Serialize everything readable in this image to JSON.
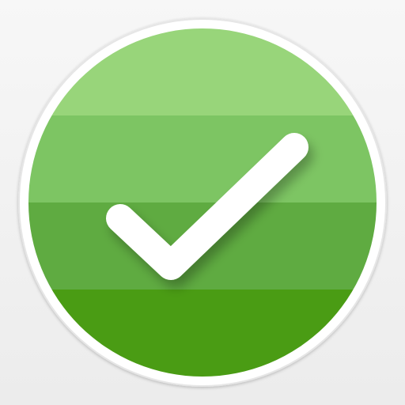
{
  "app_icon": {
    "icon": "checkmark-icon",
    "colors": {
      "background": "#f2f2f2",
      "ring": "#e6e6e6",
      "band_1": "#98d57a",
      "band_2": "#7dc563",
      "band_3": "#5fab41",
      "band_4": "#4a9c14",
      "checkmark": "#ffffff"
    }
  }
}
